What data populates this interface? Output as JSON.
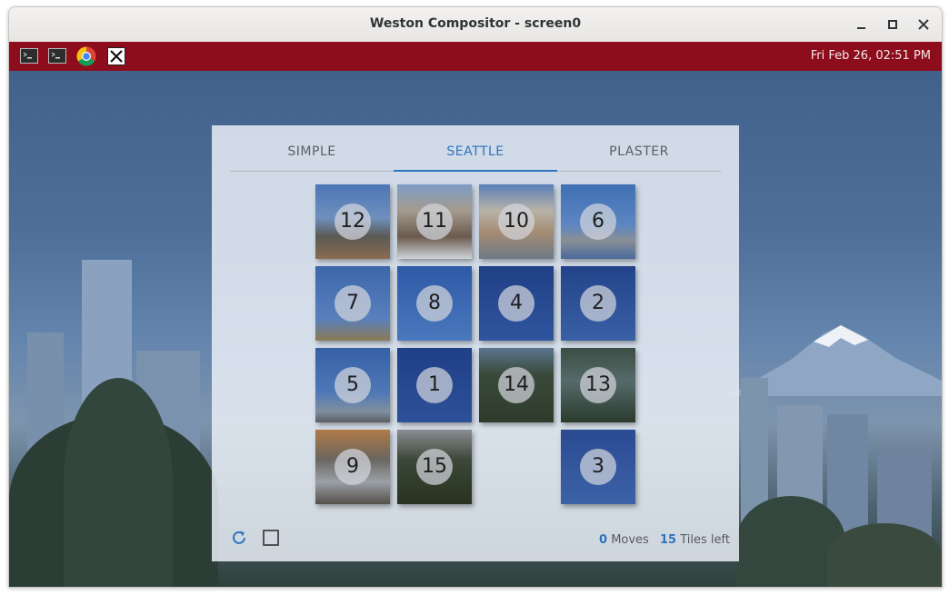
{
  "window": {
    "title": "Weston Compositor - screen0",
    "minimize": "–",
    "maximize": "□",
    "close": "✕"
  },
  "panel": {
    "launchers": [
      {
        "name": "terminal-icon"
      },
      {
        "name": "terminal-icon"
      },
      {
        "name": "chrome-icon"
      },
      {
        "name": "x-window-icon"
      }
    ],
    "clock": "Fri Feb 26, 02:51 PM",
    "color": "#8d0d1c"
  },
  "game": {
    "tabs": [
      {
        "label": "SIMPLE"
      },
      {
        "label": "SEATTLE"
      },
      {
        "label": "PLASTER"
      }
    ],
    "active_tab": "SEATTLE",
    "grid": [
      [
        "12",
        "11",
        "10",
        "6"
      ],
      [
        "7",
        "8",
        "4",
        "2"
      ],
      [
        "5",
        "1",
        "14",
        "13"
      ],
      [
        "9",
        "15",
        "",
        "3"
      ]
    ],
    "tiles": {
      "t12": "12",
      "t11": "11",
      "t10": "10",
      "t6": "6",
      "t7": "7",
      "t8": "8",
      "t4": "4",
      "t2": "2",
      "t5": "5",
      "t1": "1",
      "t14": "14",
      "t13": "13",
      "t9": "9",
      "t15": "15",
      "t3": "3"
    },
    "moves": "0",
    "moves_label": "Moves",
    "tiles_left": "15",
    "tiles_left_label": "Tiles left",
    "accent": "#2f73c0"
  }
}
